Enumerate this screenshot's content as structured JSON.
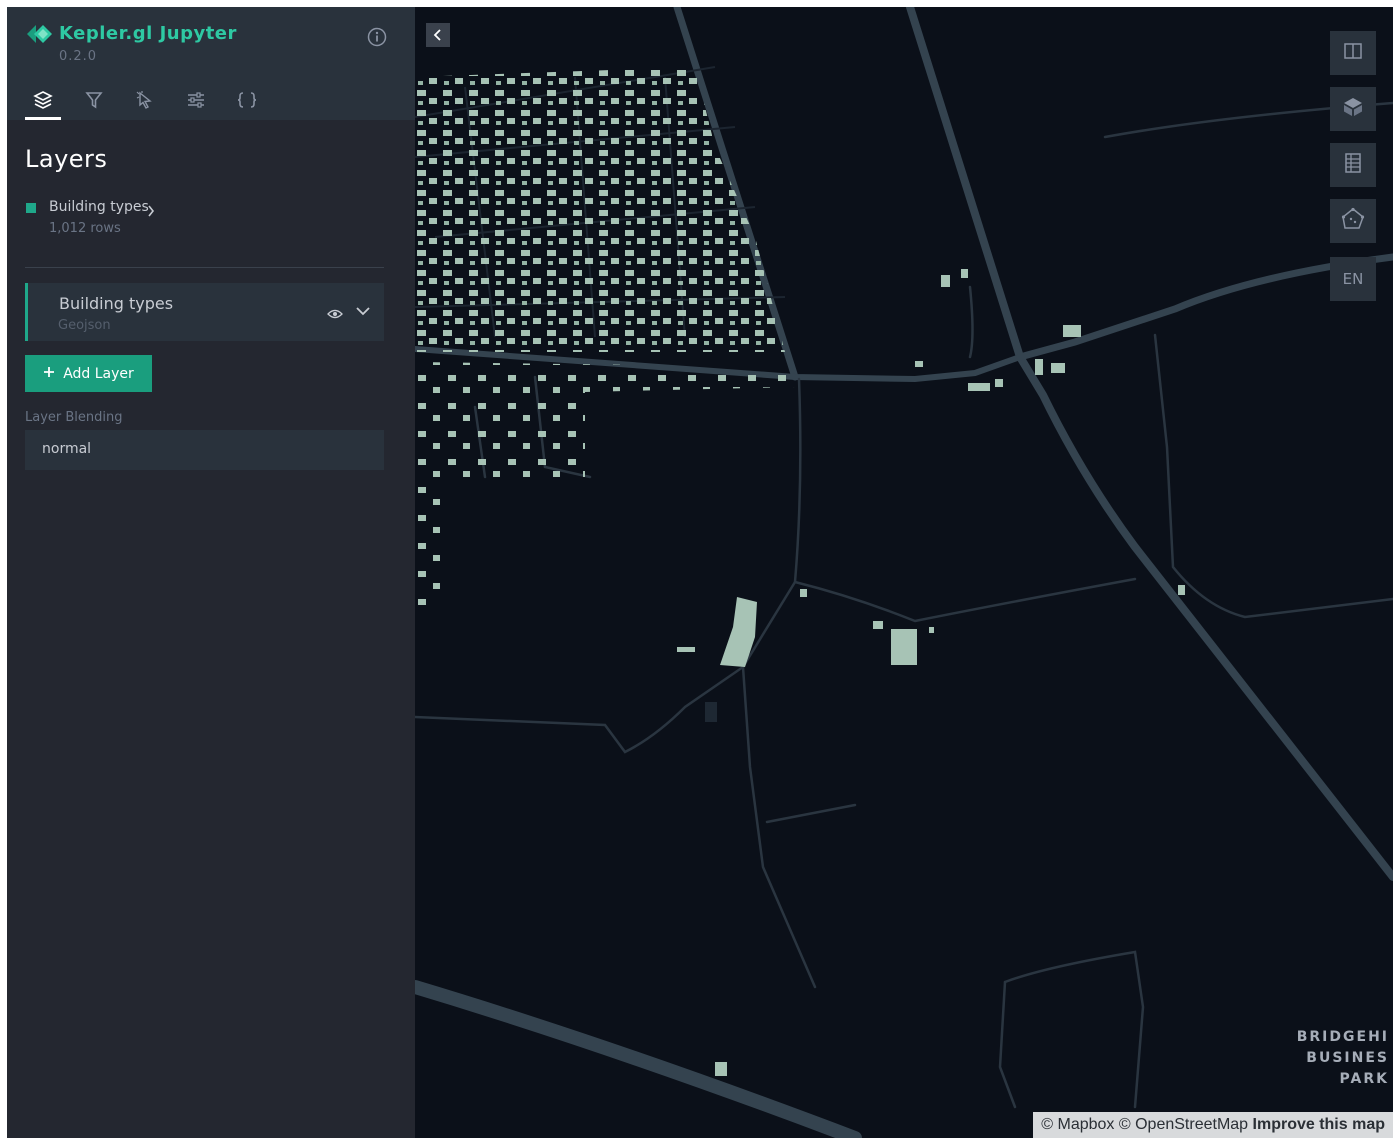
{
  "header": {
    "title": "Kepler.gl Jupyter",
    "version": "0.2.0"
  },
  "tabs": [
    {
      "id": "layers",
      "icon": "layers-icon",
      "active": true
    },
    {
      "id": "filters",
      "icon": "filter-icon",
      "active": false
    },
    {
      "id": "interactions",
      "icon": "cursor-icon",
      "active": false
    },
    {
      "id": "basemap",
      "icon": "sliders-icon",
      "active": false
    },
    {
      "id": "config",
      "icon": "braces-icon",
      "active": false
    }
  ],
  "panel": {
    "title": "Layers",
    "dataset": {
      "name": "Building types",
      "rows": "1,012 rows",
      "color": "#1fa88a"
    },
    "layer": {
      "title": "Building types",
      "type": "Geojson"
    },
    "add_layer_label": "Add Layer",
    "blending_label": "Layer Blending",
    "blending_value": "normal"
  },
  "map": {
    "controls": [
      "split-map-icon",
      "3d-map-icon",
      "legend-icon",
      "draw-polygon-icon"
    ],
    "lang": "EN",
    "place_label": [
      "BRIDGEHI",
      "BUSINES",
      "PARK"
    ],
    "attribution": {
      "mapbox": "© Mapbox",
      "osm": "© OpenStreetMap",
      "improve": "Improve this map"
    }
  },
  "colors": {
    "accent": "#1fa88a",
    "sidebar_bg": "#242730",
    "map_bg": "#0b1019",
    "road": "#34434f",
    "building": "#a7c3b5"
  }
}
